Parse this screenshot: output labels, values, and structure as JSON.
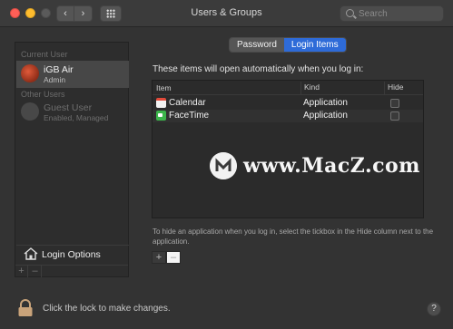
{
  "window": {
    "title": "Users & Groups",
    "nav_back": "‹",
    "nav_forward": "›"
  },
  "search": {
    "placeholder": "Search"
  },
  "sidebar": {
    "current_user_label": "Current User",
    "current_user": {
      "name": "iGB Air",
      "role": "Admin"
    },
    "other_users_label": "Other Users",
    "other_users": [
      {
        "name": "Guest User",
        "role": "Enabled, Managed"
      }
    ],
    "login_options": "Login Options",
    "add": "+",
    "remove": "–"
  },
  "tabs": [
    {
      "label": "Password",
      "active": false
    },
    {
      "label": "Login Items",
      "active": true
    }
  ],
  "login_items": {
    "intro": "These items will open automatically when you log in:",
    "columns": {
      "item": "Item",
      "kind": "Kind",
      "hide": "Hide"
    },
    "rows": [
      {
        "name": "Calendar",
        "kind": "Application",
        "icon": "calendar-icon",
        "hidden": false
      },
      {
        "name": "FaceTime",
        "kind": "Application",
        "icon": "facetime-icon",
        "hidden": false
      }
    ],
    "hint": "To hide an application when you log in, select the tickbox in the Hide column next to the application.",
    "add": "+",
    "remove": "–"
  },
  "footer": {
    "lock_text": "Click the lock to make changes.",
    "help": "?"
  },
  "watermark": {
    "text": "www.MacZ.com"
  },
  "colors": {
    "accent": "#2e6bd8",
    "close": "#ff5f57",
    "minimize": "#febc2e"
  }
}
